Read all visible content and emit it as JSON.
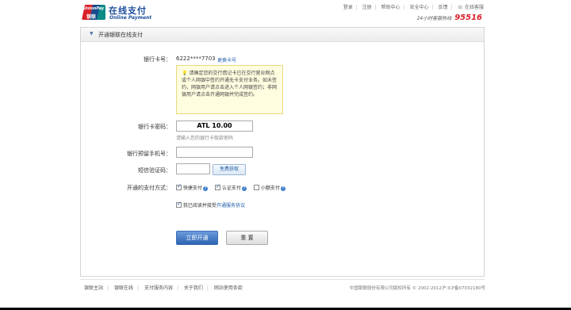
{
  "header": {
    "brand_en": "UnionPay",
    "brand_cn": "银联",
    "title": "在线支付",
    "subtitle": "Online Payment",
    "links": [
      "登录",
      "注册",
      "帮助中心",
      "安全中心",
      "反馈",
      "在线客服"
    ],
    "hotline_label": "24小时客服热线",
    "hotline_number": "95516"
  },
  "section": {
    "title": "开通银联在线支付"
  },
  "form": {
    "card_label": "银行卡号：",
    "card_value": "6222****7703",
    "change_card": "更换卡号",
    "notice": "请确定您的交行借记卡已在交行营业网点或个人网银中签约开通无卡支付业务。如未签约，网银用户请点击进入个人网银签约；非网银用户请点击开通网银并完成签约。",
    "password_label": "银行卡密码：",
    "password_value": "ATL 10.00",
    "password_hint": "请输入您的银行卡取款密码",
    "phone_label": "银行预留手机号：",
    "sms_label": "短信验证码：",
    "sms_button": "免费获取",
    "method_label": "开通的支付方式：",
    "methods": [
      {
        "label": "快捷支付",
        "checked": true
      },
      {
        "label": "认证支付",
        "checked": true
      },
      {
        "label": "小额支付",
        "checked": false
      }
    ],
    "agree_text": "我已阅读并接受",
    "agree_link": "开通服务协议",
    "submit": "立即开通",
    "reset": "重 置"
  },
  "footer": {
    "links": [
      "银联主站",
      "银联在线",
      "支付服务内容",
      "关于我们",
      "网站使用条款"
    ],
    "copyright": "中国银联股份有限公司版权所有 © 2002-2012沪 ICP备07032180号"
  }
}
